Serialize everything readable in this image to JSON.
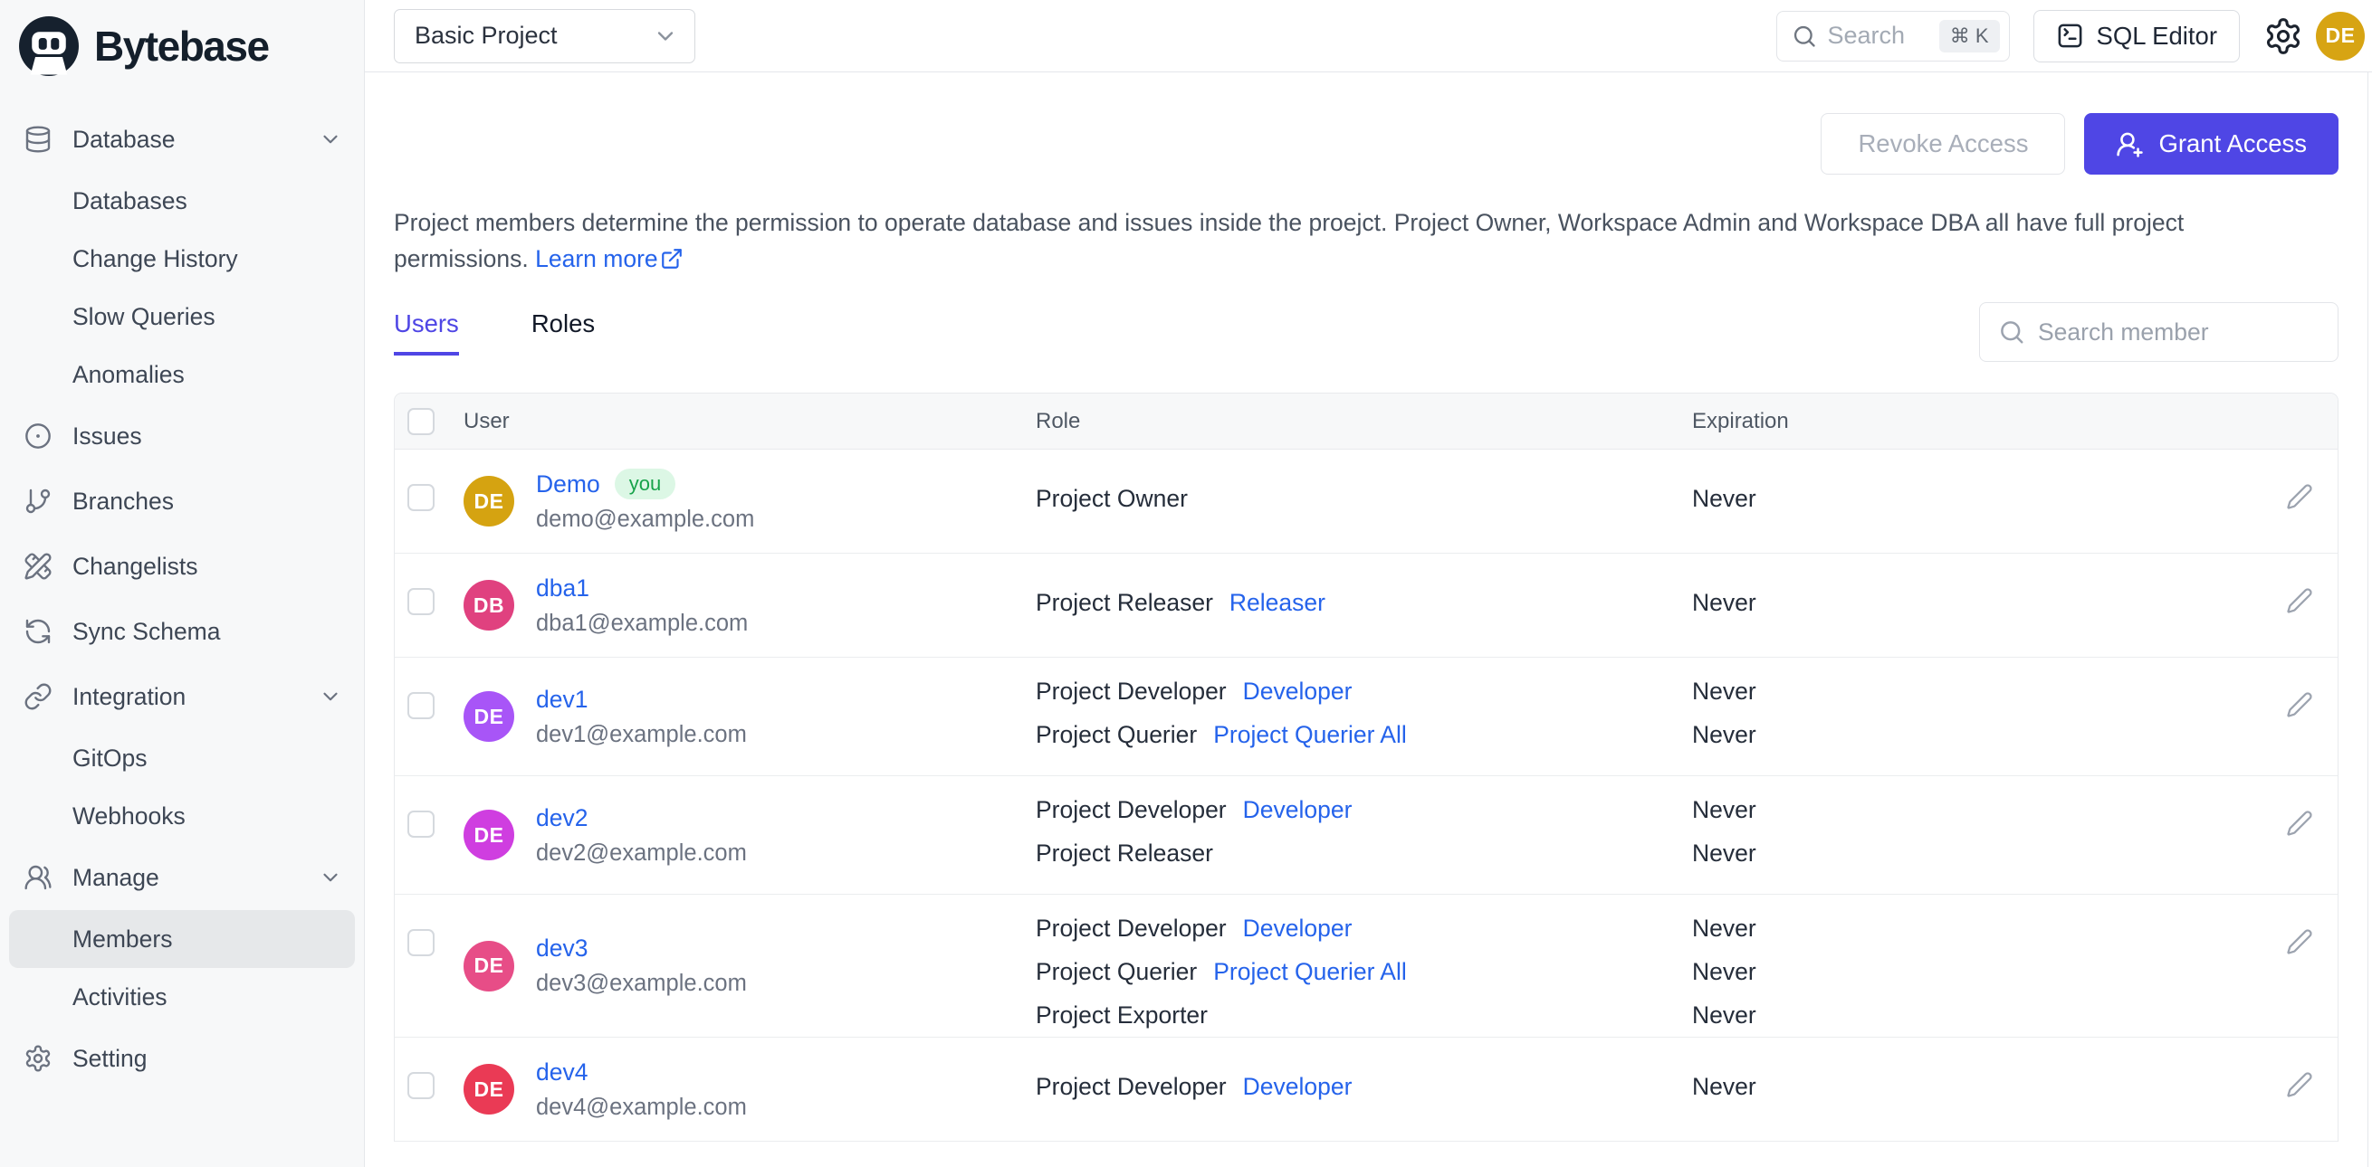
{
  "brand": {
    "name": "Bytebase"
  },
  "topbar": {
    "project_selector": {
      "value": "Basic Project"
    },
    "search": {
      "placeholder": "Search",
      "shortcut": "⌘ K"
    },
    "sql_editor_label": "SQL Editor",
    "avatar_initials": "DE"
  },
  "sidebar": {
    "items": [
      {
        "label": "Database",
        "icon": "database",
        "type": "parent",
        "chevron": true
      },
      {
        "label": "Databases",
        "type": "sub"
      },
      {
        "label": "Change History",
        "type": "sub"
      },
      {
        "label": "Slow Queries",
        "type": "sub"
      },
      {
        "label": "Anomalies",
        "type": "sub"
      },
      {
        "label": "Issues",
        "icon": "circle-dot",
        "type": "plain"
      },
      {
        "label": "Branches",
        "icon": "branch",
        "type": "plain"
      },
      {
        "label": "Changelists",
        "icon": "pencil-ruler",
        "type": "plain"
      },
      {
        "label": "Sync Schema",
        "icon": "sync",
        "type": "plain"
      },
      {
        "label": "Integration",
        "icon": "link",
        "type": "parent",
        "chevron": true
      },
      {
        "label": "GitOps",
        "type": "sub"
      },
      {
        "label": "Webhooks",
        "type": "sub"
      },
      {
        "label": "Manage",
        "icon": "users",
        "type": "parent",
        "chevron": true
      },
      {
        "label": "Members",
        "type": "sub",
        "active": true
      },
      {
        "label": "Activities",
        "type": "sub"
      },
      {
        "label": "Setting",
        "icon": "gear",
        "type": "plain"
      }
    ]
  },
  "main": {
    "actions": {
      "revoke_label": "Revoke Access",
      "grant_label": "Grant Access"
    },
    "description": {
      "text": "Project members determine the permission to operate database and issues inside the proejct. Project Owner, Workspace Admin and Workspace DBA all have full project permissions.",
      "learn_more_label": "Learn more"
    },
    "tabs": [
      {
        "label": "Users",
        "active": true
      },
      {
        "label": "Roles",
        "active": false
      }
    ],
    "member_search": {
      "placeholder": "Search member"
    },
    "table": {
      "columns": [
        "User",
        "Role",
        "Expiration"
      ],
      "rows": [
        {
          "initials": "DE",
          "avatar_color": "#d5a311",
          "name": "Demo",
          "you_badge": "you",
          "email": "demo@example.com",
          "roles": [
            {
              "name": "Project Owner",
              "link": null,
              "expiration": "Never"
            }
          ]
        },
        {
          "initials": "DB",
          "avatar_color": "#e0417f",
          "name": "dba1",
          "you_badge": null,
          "email": "dba1@example.com",
          "roles": [
            {
              "name": "Project Releaser",
              "link": "Releaser",
              "expiration": "Never"
            }
          ]
        },
        {
          "initials": "DE",
          "avatar_color": "#a855f7",
          "name": "dev1",
          "you_badge": null,
          "email": "dev1@example.com",
          "roles": [
            {
              "name": "Project Developer",
              "link": "Developer",
              "expiration": "Never"
            },
            {
              "name": "Project Querier",
              "link": "Project Querier All",
              "expiration": "Never"
            }
          ]
        },
        {
          "initials": "DE",
          "avatar_color": "#cf3ee0",
          "name": "dev2",
          "you_badge": null,
          "email": "dev2@example.com",
          "roles": [
            {
              "name": "Project Developer",
              "link": "Developer",
              "expiration": "Never"
            },
            {
              "name": "Project Releaser",
              "link": null,
              "expiration": "Never"
            }
          ]
        },
        {
          "initials": "DE",
          "avatar_color": "#e74d87",
          "name": "dev3",
          "you_badge": null,
          "email": "dev3@example.com",
          "roles": [
            {
              "name": "Project Developer",
              "link": "Developer",
              "expiration": "Never"
            },
            {
              "name": "Project Querier",
              "link": "Project Querier All",
              "expiration": "Never"
            },
            {
              "name": "Project Exporter",
              "link": null,
              "expiration": "Never"
            }
          ]
        },
        {
          "initials": "DE",
          "avatar_color": "#ea3a55",
          "name": "dev4",
          "you_badge": null,
          "email": "dev4@example.com",
          "roles": [
            {
              "name": "Project Developer",
              "link": "Developer",
              "expiration": "Never"
            }
          ]
        }
      ]
    }
  },
  "colors": {
    "accent_indigo": "#4f46e5",
    "link_blue": "#2563eb",
    "badge_green_bg": "#dcf7e5",
    "badge_green_text": "#17a34a"
  }
}
